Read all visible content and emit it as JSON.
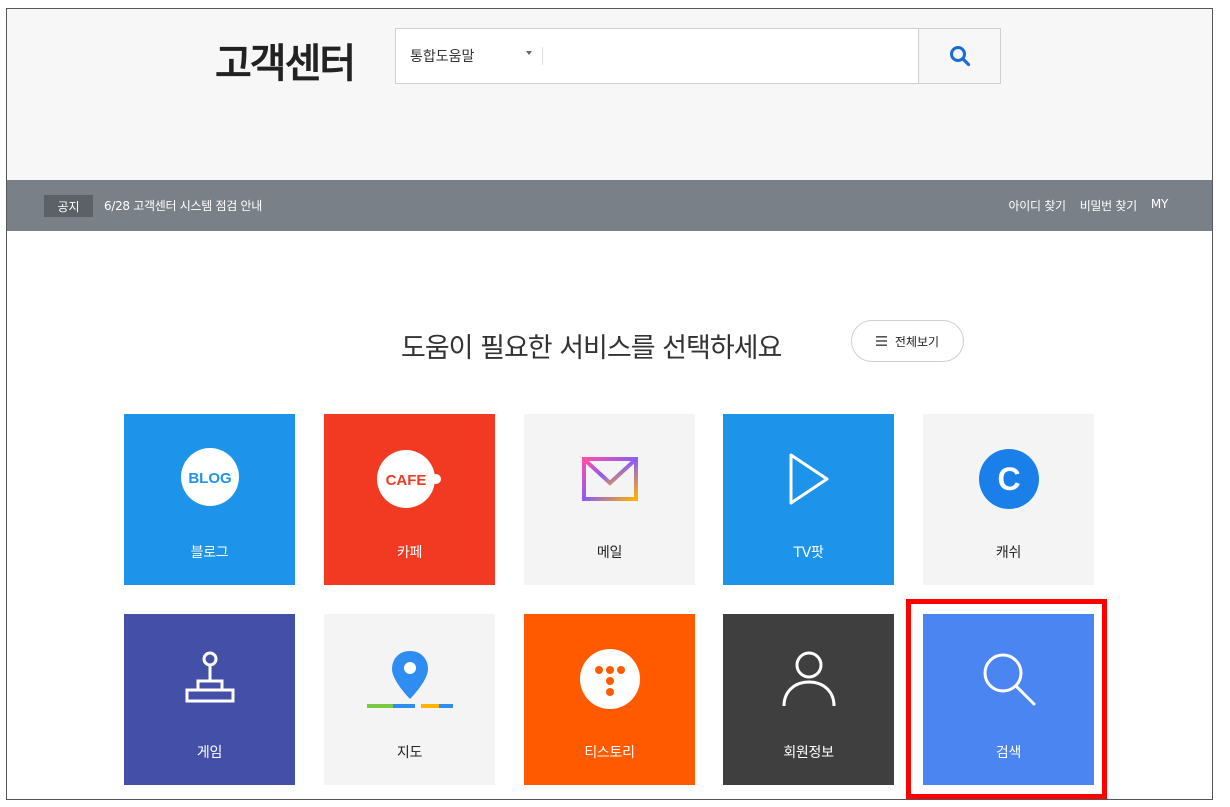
{
  "header": {
    "title": "고객센터",
    "search": {
      "scope": "통합도움말",
      "query": "",
      "button_icon": "search-icon"
    }
  },
  "notice": {
    "tag": "공지",
    "text": "6/28 고객센터 시스템 점검 안내",
    "links": [
      "아이디 찾기",
      "비밀번 찾기",
      "MY"
    ]
  },
  "main": {
    "heading": "도움이 필요한 서비스를 선택하세요",
    "view_all": "전체보기"
  },
  "services": [
    {
      "label": "블로그",
      "badge": "BLOG",
      "bg": "#1e93ea",
      "fg": "#ffffff",
      "icon": "blog-icon"
    },
    {
      "label": "카페",
      "badge": "CAFE",
      "bg": "#f23a22",
      "fg": "#ffffff",
      "icon": "cafe-icon"
    },
    {
      "label": "메일",
      "bg": "#f4f4f4",
      "fg": "#222222",
      "icon": "mail-icon"
    },
    {
      "label": "TV팟",
      "bg": "#1e93ea",
      "fg": "#ffffff",
      "icon": "play-icon"
    },
    {
      "label": "캐쉬",
      "bg": "#f4f4f4",
      "fg": "#222222",
      "icon": "cash-icon"
    },
    {
      "label": "게임",
      "bg": "#4450a8",
      "fg": "#ffffff",
      "icon": "joystick-icon"
    },
    {
      "label": "지도",
      "bg": "#f4f4f4",
      "fg": "#222222",
      "icon": "map-pin-icon"
    },
    {
      "label": "티스토리",
      "bg": "#ff5a00",
      "fg": "#ffffff",
      "icon": "tistory-icon"
    },
    {
      "label": "회원정보",
      "bg": "#3f3f3f",
      "fg": "#ffffff",
      "icon": "user-icon"
    },
    {
      "label": "검색",
      "bg": "#4a85f2",
      "fg": "#ffffff",
      "icon": "search-icon"
    }
  ],
  "highlight": {
    "target": "검색",
    "color": "#ff0000"
  }
}
